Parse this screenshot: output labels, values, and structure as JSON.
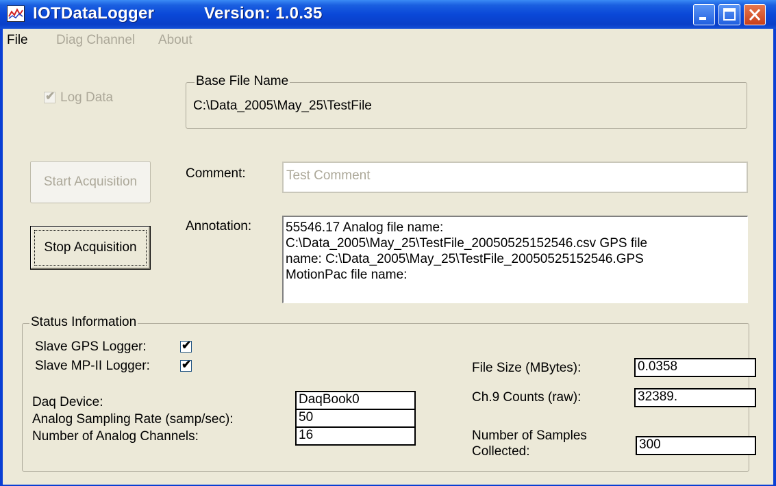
{
  "window": {
    "app_name": "IOTDataLogger",
    "version": "Version: 1.0.35"
  },
  "menu": [
    "File",
    "Diag Channel",
    "About"
  ],
  "log_data": {
    "label": "Log Data",
    "checked": true
  },
  "base_file": {
    "legend": "Base File Name",
    "value": "C:\\Data_2005\\May_25\\TestFile"
  },
  "buttons": {
    "start": "Start Acquisition",
    "stop": "Stop Acquisition"
  },
  "comment": {
    "label": "Comment:",
    "value": "Test Comment"
  },
  "annotation": {
    "label": "Annotation:",
    "lines": [
      "55546.17  Analog file name:",
      "C:\\Data_2005\\May_25\\TestFile_20050525152546.csv     GPS file",
      "name: C:\\Data_2005\\May_25\\TestFile_20050525152546.GPS",
      "MotionPac file name:"
    ]
  },
  "status": {
    "legend": "Status Information",
    "slave_gps": {
      "label": "Slave GPS Logger:",
      "checked": true
    },
    "slave_mp": {
      "label": "Slave MP-II Logger:",
      "checked": true
    },
    "daq_device": {
      "label": "Daq Device:",
      "value": "DaqBook0"
    },
    "sampling_rate": {
      "label": "Analog Sampling Rate (samp/sec):",
      "value": "50"
    },
    "num_channels": {
      "label": "Number of Analog Channels:",
      "value": "16"
    },
    "file_size": {
      "label": "File Size (MBytes):",
      "value": "0.0358"
    },
    "ch9_counts": {
      "label": "Ch.9  Counts (raw):",
      "value": "32389."
    },
    "num_samples": {
      "label_line1": "Number of Samples",
      "label_line2": "Collected:",
      "value": "300"
    }
  },
  "check_mark": "✔"
}
